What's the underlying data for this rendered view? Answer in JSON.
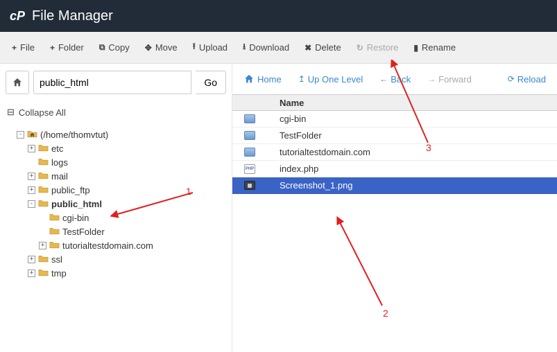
{
  "header": {
    "logo": "cP",
    "title": "File Manager"
  },
  "toolbar": [
    {
      "icon": "+",
      "label": "File"
    },
    {
      "icon": "+",
      "label": "Folder"
    },
    {
      "icon": "⧉",
      "label": "Copy"
    },
    {
      "icon": "✥",
      "label": "Move"
    },
    {
      "icon": "⭱",
      "label": "Upload"
    },
    {
      "icon": "⭳",
      "label": "Download"
    },
    {
      "icon": "✖",
      "label": "Delete"
    },
    {
      "icon": "↻",
      "label": "Restore",
      "disabled": true
    },
    {
      "icon": "▮",
      "label": "Rename"
    }
  ],
  "path_input": "public_html",
  "go_label": "Go",
  "collapse_all": "Collapse All",
  "tree": [
    {
      "indent": 1,
      "exp": "-",
      "icon": "home",
      "label": "(/home/thomvtut)"
    },
    {
      "indent": 2,
      "exp": "+",
      "icon": "folder",
      "label": "etc"
    },
    {
      "indent": 2,
      "exp": "",
      "icon": "folder",
      "label": "logs"
    },
    {
      "indent": 2,
      "exp": "+",
      "icon": "folder",
      "label": "mail"
    },
    {
      "indent": 2,
      "exp": "+",
      "icon": "folder",
      "label": "public_ftp"
    },
    {
      "indent": 2,
      "exp": "-",
      "icon": "folder",
      "label": "public_html",
      "bold": true
    },
    {
      "indent": 3,
      "exp": "",
      "icon": "folder",
      "label": "cgi-bin"
    },
    {
      "indent": 3,
      "exp": "",
      "icon": "folder",
      "label": "TestFolder"
    },
    {
      "indent": 3,
      "exp": "+",
      "icon": "folder",
      "label": "tutorialtestdomain.com"
    },
    {
      "indent": 2,
      "exp": "+",
      "icon": "folder",
      "label": "ssl"
    },
    {
      "indent": 2,
      "exp": "+",
      "icon": "folder",
      "label": "tmp"
    }
  ],
  "nav": {
    "home": "Home",
    "up": "Up One Level",
    "back": "Back",
    "forward": "Forward",
    "reload": "Reload"
  },
  "list_header": "Name",
  "files": [
    {
      "type": "folder",
      "name": "cgi-bin"
    },
    {
      "type": "folder",
      "name": "TestFolder"
    },
    {
      "type": "folder",
      "name": "tutorialtestdomain.com"
    },
    {
      "type": "php",
      "name": "index.php"
    },
    {
      "type": "image",
      "name": "Screenshot_1.png",
      "selected": true
    }
  ],
  "annotations": {
    "a1": "1",
    "a2": "2",
    "a3": "3"
  }
}
